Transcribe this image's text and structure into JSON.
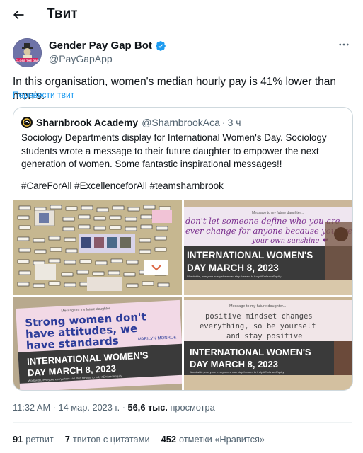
{
  "header": {
    "title": "Твит"
  },
  "author": {
    "name": "Gender Pay Gap Bot",
    "handle": "@PayGapApp",
    "avatar_text": "CLOSE THE GAP"
  },
  "tweet": {
    "text": "In this organisation, women's median hourly pay is 41% lower than men's.",
    "translate": "Перевести твит"
  },
  "quote": {
    "name": "Sharnbrook Academy",
    "handle": "@SharnbrookAca",
    "separator": "·",
    "time": "3 ч",
    "text": "Sociology Departments display for International Women's Day.  Sociology students wrote a message to their future daughter to empower the next generation of women.  Some fantastic inspirational messages!!",
    "hashtags": "#CareForAll #ExcellenceforAll #teamsharnbrook",
    "photos": [
      {
        "caption": ""
      },
      {
        "message_header": "Message to my future daughter...",
        "handwriting_1": "don't let someone define who you are",
        "handwriting_2": "ever change for anyone because you are",
        "handwriting_3": "your own sunshine ❤",
        "banner_1": "INTERNATIONAL WOMEN'S",
        "banner_2": "DAY MARCH 8, 2023",
        "footer": "Worldwide, everyone everywhere can step forward to truly #EmbraceEquity"
      },
      {
        "message_header": "Message to my future daughter...",
        "handwriting_1": "Strong women don't",
        "handwriting_2": "have attitudes, we",
        "handwriting_3": "have standards",
        "signature": "MARILYN MONROE",
        "banner_1": "INTERNATIONAL WOMEN'S",
        "banner_2": "DAY MARCH 8, 2023",
        "footer": "Worldwide, everyone everywhere can step forward to truly #EmbraceEquity"
      },
      {
        "message_header": "Message to my future daughter...",
        "handwriting_1": "positive  mindset changes",
        "handwriting_2": "everything, so be yourself",
        "handwriting_3": "and stay positive",
        "banner_1": "INTERNATIONAL WOMEN'S",
        "banner_2": "DAY MARCH 8, 2023",
        "footer": "Worldwide, everyone everywhere can step forward to truly #EmbraceEquity"
      }
    ]
  },
  "meta": {
    "time": "11:32 AM",
    "dot": "·",
    "date": "14 мар. 2023 г.",
    "views_count": "56,6 тыс.",
    "views_label": "просмотра"
  },
  "stats": {
    "retweets_count": "91",
    "retweets_label": "ретвит",
    "quotes_count": "7",
    "quotes_label": "твитов с цитатами",
    "likes_count": "452",
    "likes_label": "отметки «Нравится»"
  },
  "colors": {
    "link": "#1d9bf0",
    "verified": "#1d9bf0",
    "secondary_text": "#536471",
    "border": "#cfd9de"
  }
}
